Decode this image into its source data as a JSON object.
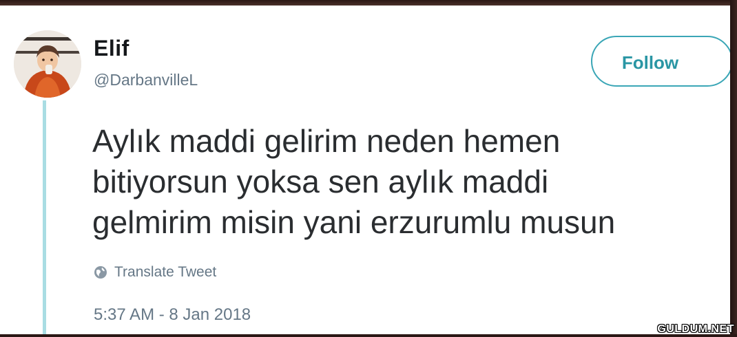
{
  "tweet": {
    "author": {
      "name": "Elif",
      "handle": "@DarbanvilleL"
    },
    "follow_label": "Follow",
    "text": "Aylık maddi gelirim neden hemen\nbitiyorsun yoksa sen aylık maddi\ngelmirim misin yani erzurumlu musun",
    "translate_label": "Translate Tweet",
    "timestamp": "5:37 AM - 8 Jan 2018"
  },
  "watermark": "GULDUM.NET",
  "colors": {
    "accent": "#3aa6b6",
    "thread_line": "#a9dde3",
    "secondary_text": "#657786",
    "body_text": "#2a2d30"
  },
  "icons": {
    "avatar": "profile-photo",
    "translate": "globe-icon"
  }
}
